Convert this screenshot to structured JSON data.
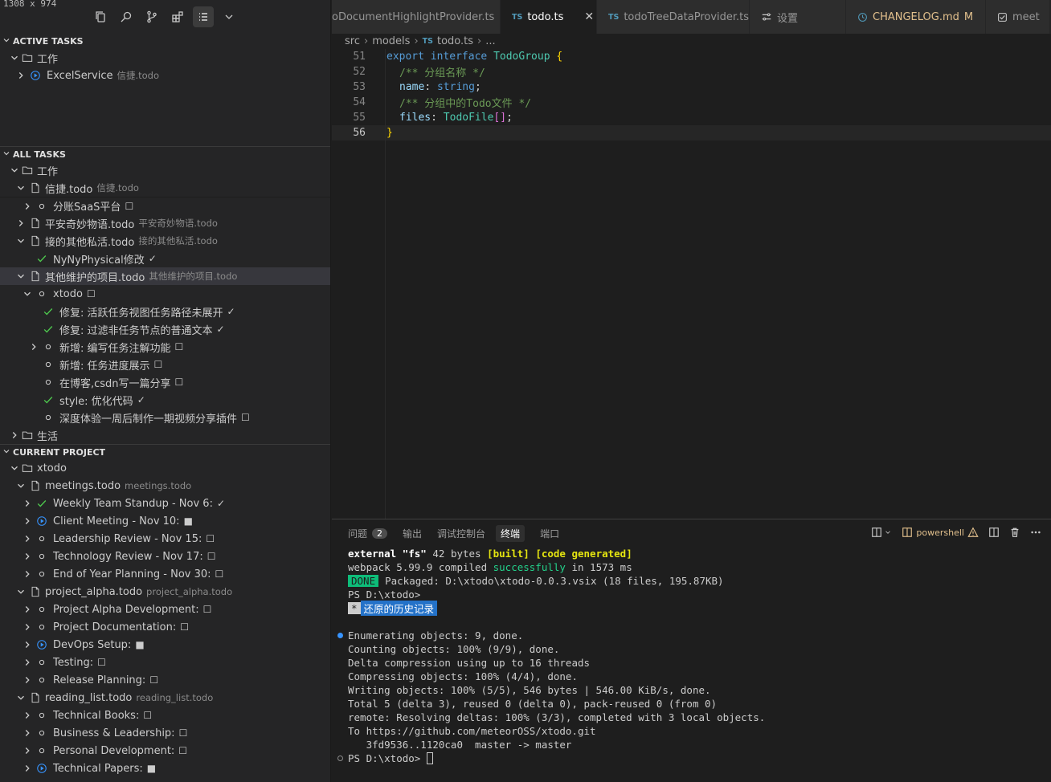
{
  "screen_size_label": "1308 x 974",
  "sidebar": {
    "sections": {
      "active": "ACTIVE TASKS",
      "all": "ALL TASKS",
      "current": "CURRENT PROJECT"
    },
    "active_tree": {
      "folder": "工作",
      "item": {
        "label": "ExcelService",
        "sub": "信捷.todo"
      }
    },
    "all_tree": {
      "folder_work": "工作",
      "file1": {
        "label": "信捷.todo",
        "sub": "信捷.todo"
      },
      "file1_task": {
        "label": "分账SaaS平台",
        "mark": "☐"
      },
      "file2": {
        "label": "平安奇妙物语.todo",
        "sub": "平安奇妙物语.todo"
      },
      "file3": {
        "label": "接的其他私活.todo",
        "sub": "接的其他私活.todo"
      },
      "file3_task": {
        "label": "NyNyPhysical修改",
        "mark": "✓"
      },
      "file4": {
        "label": "其他维护的项目.todo",
        "sub": "其他维护的项目.todo"
      },
      "xtodo": {
        "label": "xtodo",
        "mark": "☐"
      },
      "xtodo_tasks": [
        {
          "label": "修复: 活跃任务视图任务路径未展开",
          "mark": "✓"
        },
        {
          "label": "修复: 过滤非任务节点的普通文本",
          "mark": "✓"
        },
        {
          "label": "新增: 编写任务注解功能",
          "mark": "☐"
        },
        {
          "label": "新增: 任务进度展示",
          "mark": "☐"
        },
        {
          "label": "在博客,csdn写一篇分享",
          "mark": "☐"
        },
        {
          "label": "style: 优化代码",
          "mark": "✓"
        },
        {
          "label": "深度体验一周后制作一期视频分享插件",
          "mark": "☐"
        }
      ],
      "folder_life": "生活"
    },
    "current_tree": {
      "folder": "xtodo",
      "meetings": {
        "label": "meetings.todo",
        "sub": "meetings.todo"
      },
      "meetings_tasks": [
        {
          "label": "Weekly Team Standup - Nov 6:",
          "mark": "✓"
        },
        {
          "label": "Client Meeting - Nov 10:",
          "mark": "■"
        },
        {
          "label": "Leadership Review - Nov 15:",
          "mark": "☐"
        },
        {
          "label": "Technology Review - Nov 17:",
          "mark": "☐"
        },
        {
          "label": "End of Year Planning - Nov 30:",
          "mark": "☐"
        }
      ],
      "alpha": {
        "label": "project_alpha.todo",
        "sub": "project_alpha.todo"
      },
      "alpha_tasks": [
        {
          "label": "Project Alpha Development:",
          "mark": "☐"
        },
        {
          "label": "Project Documentation:",
          "mark": "☐"
        },
        {
          "label": "DevOps Setup:",
          "mark": "■"
        },
        {
          "label": "Testing:",
          "mark": "☐"
        },
        {
          "label": "Release Planning:",
          "mark": "☐"
        }
      ],
      "reading": {
        "label": "reading_list.todo",
        "sub": "reading_list.todo"
      },
      "reading_tasks": [
        {
          "label": "Technical Books:",
          "mark": "☐"
        },
        {
          "label": "Business & Leadership:",
          "mark": "☐"
        },
        {
          "label": "Personal Development:",
          "mark": "☐"
        },
        {
          "label": "Technical Papers:",
          "mark": "■"
        }
      ]
    }
  },
  "tabs": [
    {
      "label": "oDocumentHighlightProvider.ts",
      "ts": ""
    },
    {
      "label": "todo.ts",
      "ts": "TS",
      "close": "✕"
    },
    {
      "label": "todoTreeDataProvider.ts",
      "ts": "TS"
    },
    {
      "label": "设置",
      "icon": "settings"
    },
    {
      "label": "CHANGELOG.md",
      "mod": "M"
    },
    {
      "label": "meet"
    }
  ],
  "breadcrumb": {
    "p1": "src",
    "p2": "models",
    "ts": "TS",
    "p3": "todo.ts",
    "p4": "..."
  },
  "code": {
    "lines": [
      "51",
      "52",
      "53",
      "54",
      "55",
      "56"
    ],
    "l51": {
      "k1": "export",
      "k2": "interface",
      "t": "TodoGroup",
      "b": "{"
    },
    "l52": "/** 分组名称 */",
    "l53": {
      "p": "name",
      "c": ":",
      "t": "string",
      "s": ";"
    },
    "l54": "/** 分组中的Todo文件 */",
    "l55": {
      "p": "files",
      "c": ":",
      "t": "TodoFile",
      "br": "[]",
      "s": ";"
    },
    "l56": "}"
  },
  "panel": {
    "tabs": {
      "problems": "问题",
      "problems_count": "2",
      "output": "输出",
      "debug": "调试控制台",
      "terminal": "终端",
      "ports": "端口"
    },
    "shell": "powershell",
    "terminal": {
      "l1": {
        "a": "external ",
        "b": "\"fs\"",
        "c": " 42 bytes ",
        "d": "[built]",
        "e": " ",
        "f": "[code generated]"
      },
      "l2": {
        "a": "webpack 5.99.9 compiled ",
        "b": "successfully",
        "c": " in 1573 ms"
      },
      "l3": {
        "done": "DONE",
        "text": "Packaged: D:\\xtodo\\xtodo-0.0.3.vsix (18 files, 195.87KB)"
      },
      "l4": "PS D:\\xtodo>",
      "l5": {
        "star": "*",
        "hist": "还原的历史记录"
      },
      "l7": "Enumerating objects: 9, done.",
      "l8": "Counting objects: 100% (9/9), done.",
      "l9": "Delta compression using up to 16 threads",
      "l10": "Compressing objects: 100% (4/4), done.",
      "l11": "Writing objects: 100% (5/5), 546 bytes | 546.00 KiB/s, done.",
      "l12": "Total 5 (delta 3), reused 0 (delta 0), pack-reused 0 (from 0)",
      "l13": "remote: Resolving deltas: 100% (3/3), completed with 3 local objects.",
      "l14": "To https://github.com/meteorOSS/xtodo.git",
      "l15": "   3fd9536..1120ca0  master -> master",
      "l16": "PS D:\\xtodo> "
    }
  }
}
